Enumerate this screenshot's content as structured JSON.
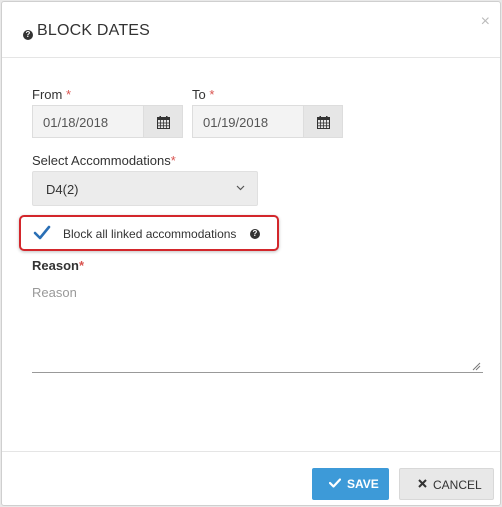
{
  "dialog": {
    "title": "BLOCK DATES",
    "close_symbol": "×"
  },
  "from": {
    "label": "From",
    "required_mark": "*",
    "value": "01/18/2018"
  },
  "to": {
    "label": "To",
    "required_mark": "*",
    "value": "01/19/2018"
  },
  "accommodations": {
    "label": "Select Accommodations",
    "required_mark": "*",
    "selected": "D4(2)"
  },
  "linked": {
    "label": "Block all linked accommodations",
    "checked": true
  },
  "reason": {
    "label": "Reason",
    "required_mark": "*",
    "placeholder": "Reason",
    "value": ""
  },
  "footer": {
    "save_label": "SAVE",
    "cancel_label": "CANCEL"
  },
  "colors": {
    "primary": "#3d9ad8",
    "required": "#d9534f",
    "highlight": "#d3262b"
  }
}
